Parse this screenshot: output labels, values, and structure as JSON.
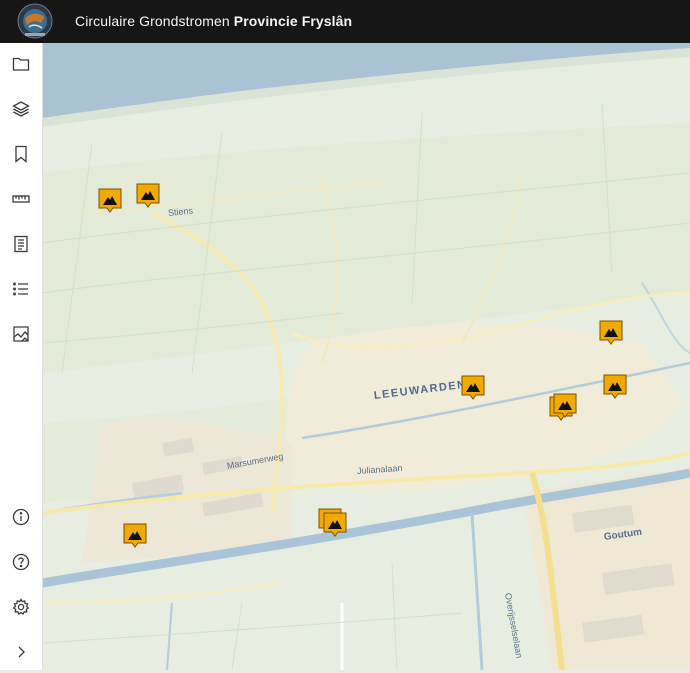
{
  "header": {
    "title_prefix": "Circulaire Grondstromen ",
    "title_strong": "Provincie Fryslân",
    "logo_icon": "logo-globe-icon"
  },
  "sidebar": {
    "top_items": [
      {
        "icon": "folder-icon"
      },
      {
        "icon": "layers-icon"
      },
      {
        "icon": "bookmark-icon"
      },
      {
        "icon": "ruler-icon"
      },
      {
        "icon": "report-icon"
      },
      {
        "icon": "list-icon"
      },
      {
        "icon": "map-legend-icon"
      }
    ],
    "bottom_items": [
      {
        "icon": "info-icon"
      },
      {
        "icon": "help-icon"
      },
      {
        "icon": "settings-icon"
      },
      {
        "icon": "expand-chevron-icon"
      }
    ]
  },
  "map": {
    "labels": {
      "city": "LEEUWARDEN",
      "street_1": "Julianalaan",
      "street_2": "Overijsselselaan",
      "street_3": "Marsumerweg",
      "district": "Goutum",
      "village": "Stiens"
    },
    "colors": {
      "marker_fill": "#f2a900",
      "marker_stroke": "#7a5200",
      "water": "#aac3d4",
      "land": "#e9ece2",
      "urban": "#f1ecd9"
    }
  }
}
